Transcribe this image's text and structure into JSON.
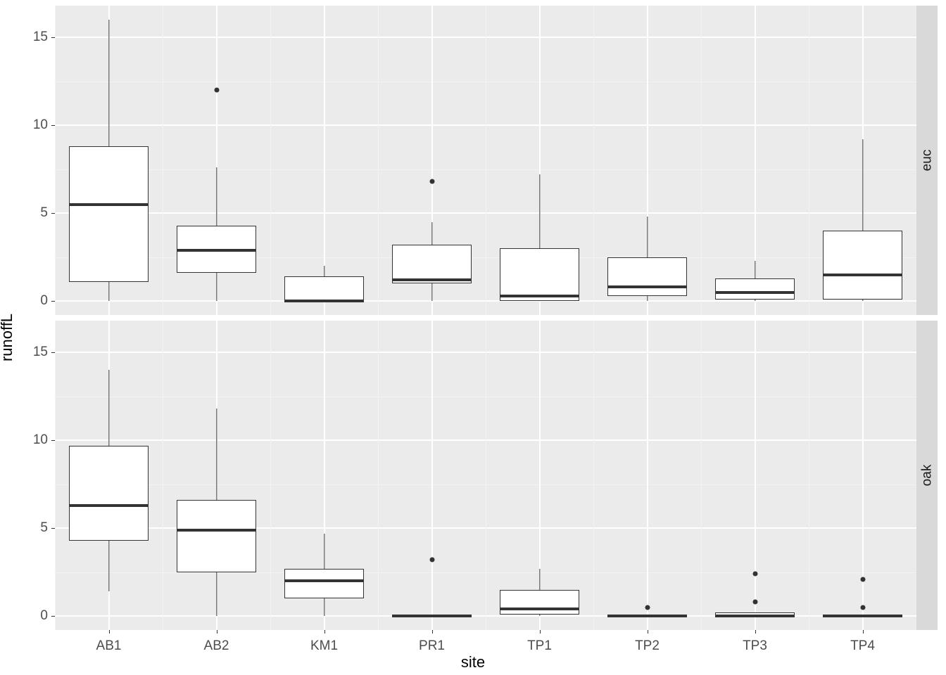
{
  "xlabel": "site",
  "ylabel": "runoffL",
  "categories": [
    "AB1",
    "AB2",
    "KM1",
    "PR1",
    "TP1",
    "TP2",
    "TP3",
    "TP4"
  ],
  "facets": [
    "euc",
    "oak"
  ],
  "y_breaks": [
    0,
    5,
    10,
    15
  ],
  "ylim": [
    -0.8,
    16.8
  ],
  "chart_data": {
    "type": "boxplot",
    "xlabel": "site",
    "ylabel": "runoffL",
    "categories": [
      "AB1",
      "AB2",
      "KM1",
      "PR1",
      "TP1",
      "TP2",
      "TP3",
      "TP4"
    ],
    "facet_var": "tree",
    "facets": [
      "euc",
      "oak"
    ],
    "ylim": [
      -0.8,
      16.8
    ],
    "y_breaks": [
      0,
      5,
      10,
      15
    ],
    "series": [
      {
        "facet": "euc",
        "boxes": [
          {
            "site": "AB1",
            "ymin": 0.0,
            "lower": 1.1,
            "middle": 5.5,
            "upper": 8.8,
            "ymax": 16.0,
            "outliers": []
          },
          {
            "site": "AB2",
            "ymin": 0.0,
            "lower": 1.6,
            "middle": 2.9,
            "upper": 4.3,
            "ymax": 7.6,
            "outliers": [
              12.0
            ]
          },
          {
            "site": "KM1",
            "ymin": 0.0,
            "lower": 0.0,
            "middle": 0.0,
            "upper": 1.4,
            "ymax": 2.0,
            "outliers": []
          },
          {
            "site": "PR1",
            "ymin": 0.0,
            "lower": 1.0,
            "middle": 1.2,
            "upper": 3.2,
            "ymax": 4.5,
            "outliers": [
              6.8
            ]
          },
          {
            "site": "TP1",
            "ymin": 0.0,
            "lower": 0.0,
            "middle": 0.3,
            "upper": 3.0,
            "ymax": 7.2,
            "outliers": []
          },
          {
            "site": "TP2",
            "ymin": 0.0,
            "lower": 0.3,
            "middle": 0.8,
            "upper": 2.5,
            "ymax": 4.8,
            "outliers": []
          },
          {
            "site": "TP3",
            "ymin": 0.0,
            "lower": 0.1,
            "middle": 0.5,
            "upper": 1.3,
            "ymax": 2.3,
            "outliers": []
          },
          {
            "site": "TP4",
            "ymin": 0.0,
            "lower": 0.1,
            "middle": 1.5,
            "upper": 4.0,
            "ymax": 9.2,
            "outliers": []
          }
        ]
      },
      {
        "facet": "oak",
        "boxes": [
          {
            "site": "AB1",
            "ymin": 1.4,
            "lower": 4.3,
            "middle": 6.3,
            "upper": 9.7,
            "ymax": 14.0,
            "outliers": []
          },
          {
            "site": "AB2",
            "ymin": 0.0,
            "lower": 2.5,
            "middle": 4.9,
            "upper": 6.6,
            "ymax": 11.8,
            "outliers": []
          },
          {
            "site": "KM1",
            "ymin": 0.0,
            "lower": 1.0,
            "middle": 2.0,
            "upper": 2.7,
            "ymax": 4.7,
            "outliers": []
          },
          {
            "site": "PR1",
            "ymin": 0.0,
            "lower": 0.0,
            "middle": 0.0,
            "upper": 0.1,
            "ymax": 0.1,
            "outliers": [
              3.2
            ]
          },
          {
            "site": "TP1",
            "ymin": 0.0,
            "lower": 0.1,
            "middle": 0.4,
            "upper": 1.5,
            "ymax": 2.7,
            "outliers": []
          },
          {
            "site": "TP2",
            "ymin": 0.0,
            "lower": 0.0,
            "middle": 0.0,
            "upper": 0.05,
            "ymax": 0.05,
            "outliers": [
              0.5
            ]
          },
          {
            "site": "TP3",
            "ymin": 0.0,
            "lower": 0.0,
            "middle": 0.0,
            "upper": 0.2,
            "ymax": 0.2,
            "outliers": [
              0.8,
              2.4
            ]
          },
          {
            "site": "TP4",
            "ymin": 0.0,
            "lower": 0.0,
            "middle": 0.0,
            "upper": 0.1,
            "ymax": 0.1,
            "outliers": [
              0.5,
              2.1
            ]
          }
        ]
      }
    ]
  }
}
